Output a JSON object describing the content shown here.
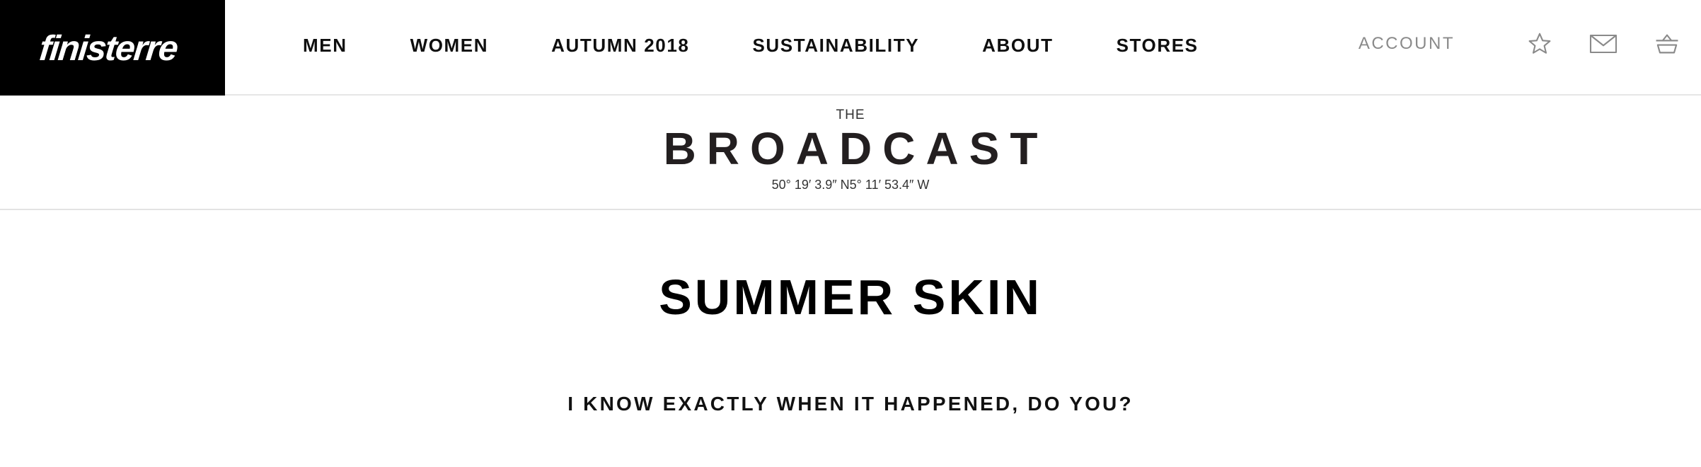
{
  "brand": {
    "logo_text": "finisterre",
    "logo_bg": "#000000",
    "logo_fg": "#ffffff"
  },
  "nav": {
    "items": [
      {
        "label": "MEN"
      },
      {
        "label": "WOMEN"
      },
      {
        "label": "AUTUMN 2018"
      },
      {
        "label": "SUSTAINABILITY"
      },
      {
        "label": "ABOUT"
      },
      {
        "label": "STORES"
      }
    ]
  },
  "utility": {
    "account_label": "ACCOUNT",
    "icons": [
      "star-icon",
      "mail-icon",
      "basket-icon"
    ],
    "icon_color": "#8a8a8a"
  },
  "masthead": {
    "pre": "THE",
    "title": "BROADCAST",
    "coords": "50° 19′ 3.9″ N5° 11′ 53.4″ W"
  },
  "article": {
    "title": "SUMMER SKIN",
    "subtitle": "I KNOW EXACTLY WHEN IT HAPPENED, DO YOU?"
  }
}
